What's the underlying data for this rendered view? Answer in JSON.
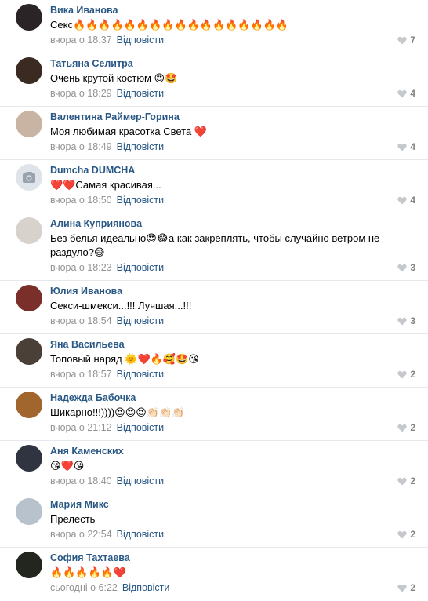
{
  "comments": [
    {
      "author": "Вика Иванова",
      "text": "Секс🔥🔥🔥🔥🔥🔥🔥🔥🔥🔥🔥🔥🔥🔥🔥🔥🔥",
      "time": "вчора о 18:37",
      "reply": "Відповісти",
      "likes": "7",
      "avatar": "#2b2427"
    },
    {
      "author": "Татьяна Селитра",
      "text": "Очень крутой костюм 😍🤩",
      "time": "вчора о 18:29",
      "reply": "Відповісти",
      "likes": "4",
      "avatar": "#3a2a22"
    },
    {
      "author": "Валентина Раймер-Горина",
      "text": "Моя любимая красотка Света ❤️",
      "time": "вчора о 18:49",
      "reply": "Відповісти",
      "likes": "4",
      "avatar": "#c9b4a4"
    },
    {
      "author": "Dumcha DUMCHA",
      "text": "❤️❤️Самая красивая...",
      "time": "вчора о 18:50",
      "reply": "Відповісти",
      "likes": "4",
      "avatar": "camera"
    },
    {
      "author": "Алина Куприянова",
      "text": "Без белья идеально😍😂а как закреплять, чтобы случайно ветром не раздуло?😅",
      "time": "вчора о 18:23",
      "reply": "Відповісти",
      "likes": "3",
      "avatar": "#d8d2cc"
    },
    {
      "author": "Юлия Иванова",
      "text": "Секси-шмекси...!!! Лучшая...!!!",
      "time": "вчора о 18:54",
      "reply": "Відповісти",
      "likes": "3",
      "avatar": "#7a2f2a"
    },
    {
      "author": "Яна Васильева",
      "text": "Топовый наряд 🌞❤️🔥🥰🤩😘",
      "time": "вчора о 18:57",
      "reply": "Відповісти",
      "likes": "2",
      "avatar": "#4a4038"
    },
    {
      "author": "Надежда Бабочка",
      "text": "Шикарно!!!))))😍😍😍👏🏻👏🏻👏🏻",
      "time": "вчора о 21:12",
      "reply": "Відповісти",
      "likes": "2",
      "avatar": "#a0662e"
    },
    {
      "author": "Аня Каменских",
      "text": "😘❤️😘",
      "time": "вчора о 18:40",
      "reply": "Відповісти",
      "likes": "2",
      "avatar": "#2f3440"
    },
    {
      "author": "Мария Микс",
      "text": "Прелесть",
      "time": "вчора о 22:54",
      "reply": "Відповісти",
      "likes": "2",
      "avatar": "#b8c2cc"
    },
    {
      "author": "София Тахтаева",
      "text": "🔥🔥🔥🔥🔥❤️",
      "time": "сьогодні о 6:22",
      "reply": "Відповісти",
      "likes": "2",
      "avatar": "#22261f"
    }
  ],
  "icons": {
    "like": "heart-icon",
    "no_photo": "camera-icon"
  },
  "colors": {
    "link": "#2a5885",
    "meta": "#939393",
    "likes": "#828282",
    "divider": "#e7e8ec"
  }
}
